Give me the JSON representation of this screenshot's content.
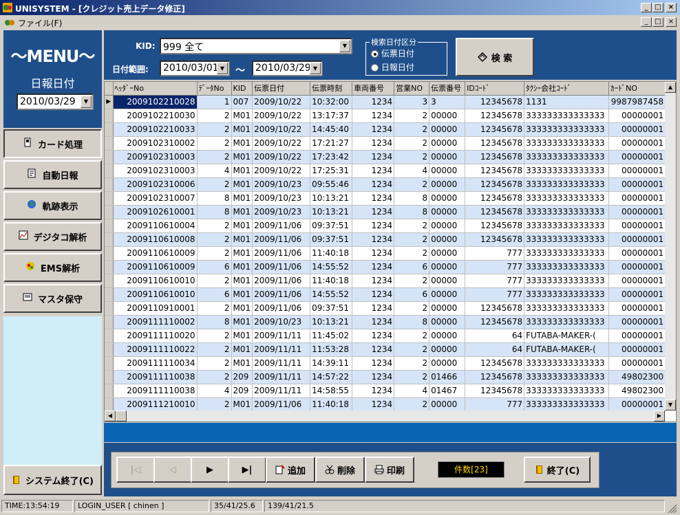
{
  "window": {
    "title": "UNISYSTEM - [クレジット売上データ修正]",
    "min": "_",
    "max": "□",
    "close": "×",
    "restore": "🗗"
  },
  "menubar": {
    "file": "ファイル(F)"
  },
  "left": {
    "menu_title": "～MENU～",
    "day_label": "日報日付",
    "day_value": "2010/03/29",
    "nav": [
      {
        "label": "カード処理",
        "icon": "card-icon"
      },
      {
        "label": "自動日報",
        "icon": "report-icon"
      },
      {
        "label": "軌跡表示",
        "icon": "globe-icon"
      },
      {
        "label": "デジタコ解析",
        "icon": "chart-icon"
      },
      {
        "label": "EMS解析",
        "icon": "ems-icon"
      },
      {
        "label": "マスタ保守",
        "icon": "master-icon"
      }
    ],
    "exit_label": "システム終了(C)"
  },
  "filter": {
    "kid_label": "KID:",
    "kid_value": "999 全て",
    "range_label": "日付範囲:",
    "date_from": "2010/03/01",
    "tilde": "～",
    "date_to": "2010/03/29",
    "group_title": "検索日付区分",
    "radio1": "伝票日付",
    "radio2": "日報日付",
    "search_label": "検 索"
  },
  "grid": {
    "headers": [
      "ﾍｯﾀﾞｰNo",
      "ﾃﾞｰﾀNo",
      "KID",
      "伝票日付",
      "伝票時刻",
      "車両番号",
      "営業NO",
      "伝票番号",
      "IDｺｰﾄﾞ",
      "ﾀｸｼｰ会社ｺｰﾄﾞ",
      "ｶｰﾄﾞNO"
    ],
    "rows": [
      [
        "2009102210028",
        "1",
        "007",
        "2009/10/22",
        "10:32:00",
        "1234",
        "3",
        "3",
        "12345678",
        "1131",
        "9987987458"
      ],
      [
        "2009102210030",
        "2",
        "M01",
        "2009/10/22",
        "13:17:37",
        "1234",
        "2",
        "00000",
        "12345678",
        "333333333333333",
        "00000001"
      ],
      [
        "2009102210033",
        "2",
        "M01",
        "2009/10/22",
        "14:45:40",
        "1234",
        "2",
        "00000",
        "12345678",
        "333333333333333",
        "00000001"
      ],
      [
        "2009102310002",
        "2",
        "M01",
        "2009/10/22",
        "17:21:27",
        "1234",
        "2",
        "00000",
        "12345678",
        "333333333333333",
        "00000001"
      ],
      [
        "2009102310003",
        "2",
        "M01",
        "2009/10/22",
        "17:23:42",
        "1234",
        "2",
        "00000",
        "12345678",
        "333333333333333",
        "00000001"
      ],
      [
        "2009102310003",
        "4",
        "M01",
        "2009/10/22",
        "17:25:31",
        "1234",
        "4",
        "00000",
        "12345678",
        "333333333333333",
        "00000001"
      ],
      [
        "2009102310006",
        "2",
        "M01",
        "2009/10/23",
        "09:55:46",
        "1234",
        "2",
        "00000",
        "12345678",
        "333333333333333",
        "00000001"
      ],
      [
        "2009102310007",
        "8",
        "M01",
        "2009/10/23",
        "10:13:21",
        "1234",
        "8",
        "00000",
        "12345678",
        "333333333333333",
        "00000001"
      ],
      [
        "2009102610001",
        "8",
        "M01",
        "2009/10/23",
        "10:13:21",
        "1234",
        "8",
        "00000",
        "12345678",
        "333333333333333",
        "00000001"
      ],
      [
        "2009110610004",
        "2",
        "M01",
        "2009/11/06",
        "09:37:51",
        "1234",
        "2",
        "00000",
        "12345678",
        "333333333333333",
        "00000001"
      ],
      [
        "2009110610008",
        "2",
        "M01",
        "2009/11/06",
        "09:37:51",
        "1234",
        "2",
        "00000",
        "12345678",
        "333333333333333",
        "00000001"
      ],
      [
        "2009110610009",
        "2",
        "M01",
        "2009/11/06",
        "11:40:18",
        "1234",
        "2",
        "00000",
        "777",
        "333333333333333",
        "00000001"
      ],
      [
        "2009110610009",
        "6",
        "M01",
        "2009/11/06",
        "14:55:52",
        "1234",
        "6",
        "00000",
        "777",
        "333333333333333",
        "00000001"
      ],
      [
        "2009110610010",
        "2",
        "M01",
        "2009/11/06",
        "11:40:18",
        "1234",
        "2",
        "00000",
        "777",
        "333333333333333",
        "00000001"
      ],
      [
        "2009110610010",
        "6",
        "M01",
        "2009/11/06",
        "14:55:52",
        "1234",
        "6",
        "00000",
        "777",
        "333333333333333",
        "00000001"
      ],
      [
        "2009110910001",
        "2",
        "M01",
        "2009/11/06",
        "09:37:51",
        "1234",
        "2",
        "00000",
        "12345678",
        "333333333333333",
        "00000001"
      ],
      [
        "2009111110002",
        "8",
        "M01",
        "2009/10/23",
        "10:13:21",
        "1234",
        "8",
        "00000",
        "12345678",
        "333333333333333",
        "00000001"
      ],
      [
        "2009111110020",
        "2",
        "M01",
        "2009/11/11",
        "11:45:02",
        "1234",
        "2",
        "00000",
        "64",
        "FUTABA-MAKER-(",
        "00000001"
      ],
      [
        "2009111110022",
        "2",
        "M01",
        "2009/11/11",
        "11:53:28",
        "1234",
        "2",
        "00000",
        "64",
        "FUTABA-MAKER-(",
        "00000001"
      ],
      [
        "2009111110034",
        "2",
        "M01",
        "2009/11/11",
        "14:39:11",
        "1234",
        "2",
        "00000",
        "12345678",
        "333333333333333",
        "00000001"
      ],
      [
        "2009111110038",
        "2",
        "209",
        "2009/11/11",
        "14:57:22",
        "1234",
        "2",
        "01466",
        "12345678",
        "333333333333333",
        "49802300"
      ],
      [
        "2009111110038",
        "4",
        "209",
        "2009/11/11",
        "14:58:55",
        "1234",
        "4",
        "01467",
        "12345678",
        "333333333333333",
        "49802300"
      ],
      [
        "2009111210010",
        "2",
        "M01",
        "2009/11/06",
        "11:40:18",
        "1234",
        "2",
        "00000",
        "777",
        "333333333333333",
        "00000001"
      ]
    ]
  },
  "toolbar": {
    "first": "|◁",
    "prev": "◁",
    "next": "▶",
    "last": "▶|",
    "add": "追加",
    "delete": "削除",
    "print": "印刷",
    "count": "件数[23]",
    "close": "終了(C)"
  },
  "status": {
    "time": "TIME:13:54:19",
    "user": "LOGIN_USER [ chinen ]",
    "coord1": "35/41/25.6",
    "coord2": "139/41/21.5"
  }
}
